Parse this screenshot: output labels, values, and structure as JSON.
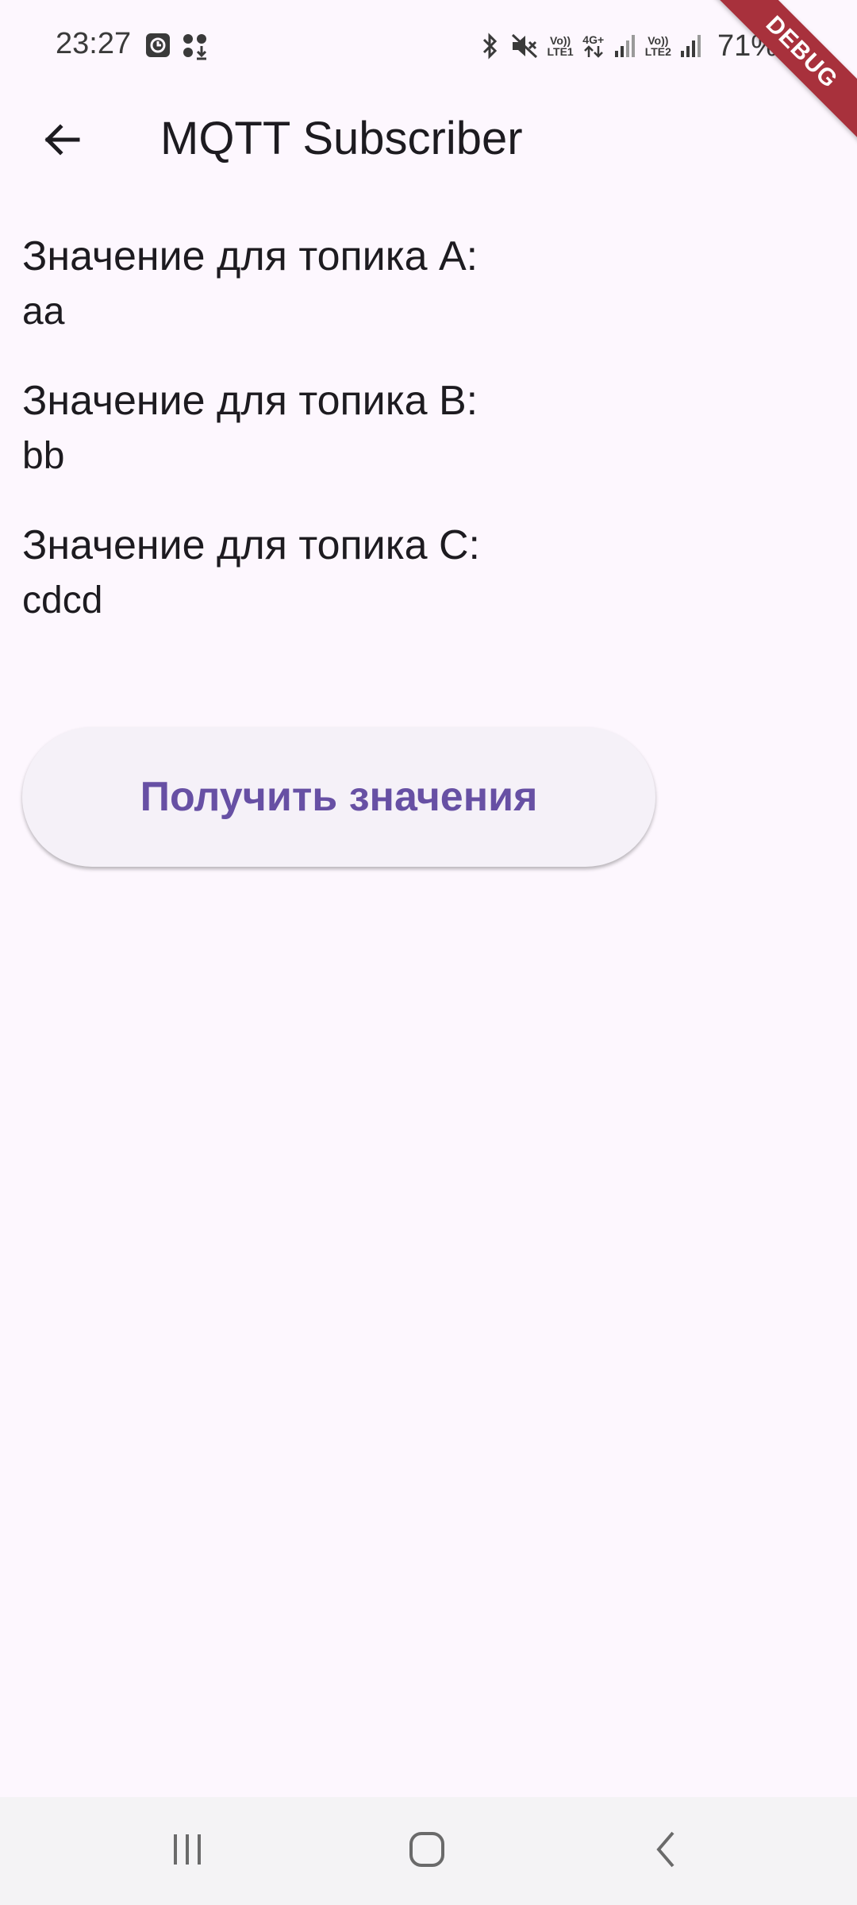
{
  "status_bar": {
    "time": "23:27",
    "sim1_label_top": "Vo))",
    "sim1_label_bottom": "LTE1",
    "net_label_top": "4G+",
    "sim2_label_top": "Vo))",
    "sim2_label_bottom": "LTE2",
    "battery_percent": "71%",
    "icons": [
      "clock-notification-icon",
      "apps-download-icon",
      "bluetooth-icon",
      "mute-icon",
      "volte-lte1-icon",
      "4g-plus-icon",
      "signal-icon",
      "volte-lte2-icon",
      "signal-icon",
      "battery-icon"
    ]
  },
  "debug_banner": "DEBUG",
  "app_bar": {
    "title": "MQTT Subscriber",
    "back_icon": "arrow-back-icon"
  },
  "topics": [
    {
      "label": "Значение для топика A:",
      "value": "aa"
    },
    {
      "label": "Значение для топика B:",
      "value": "bb"
    },
    {
      "label": "Значение для топика C:",
      "value": "cdcd"
    }
  ],
  "fetch_button_label": "Получить значения",
  "colors": {
    "background": "#fdf7fe",
    "button_background": "#f5f1f8",
    "button_text": "#6750a4",
    "debug_banner": "#a8313c",
    "nav_bar": "#f4f3f5"
  },
  "nav_bar": {
    "buttons": [
      "recent-apps-icon",
      "home-icon",
      "back-icon"
    ]
  }
}
